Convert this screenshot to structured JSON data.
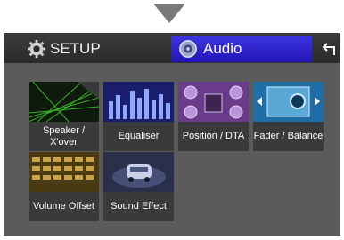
{
  "header": {
    "setup_label": "SETUP",
    "audio_label": "Audio"
  },
  "tiles": [
    {
      "label": "Speaker / X'over"
    },
    {
      "label": "Equaliser"
    },
    {
      "label": "Position / DTA"
    },
    {
      "label": "Fader / Balance"
    },
    {
      "label": "Volume Offset"
    },
    {
      "label": "Sound Effect"
    }
  ],
  "icons": {
    "down_arrow": "down-arrow-icon",
    "setup": "gear-icon",
    "audio": "speaker-icon",
    "back": "back-arrow-icon"
  },
  "colors": {
    "audio_tab": "#3a30dc",
    "background": "#5b5b5b",
    "tile_bg": "#3a3a3a"
  }
}
